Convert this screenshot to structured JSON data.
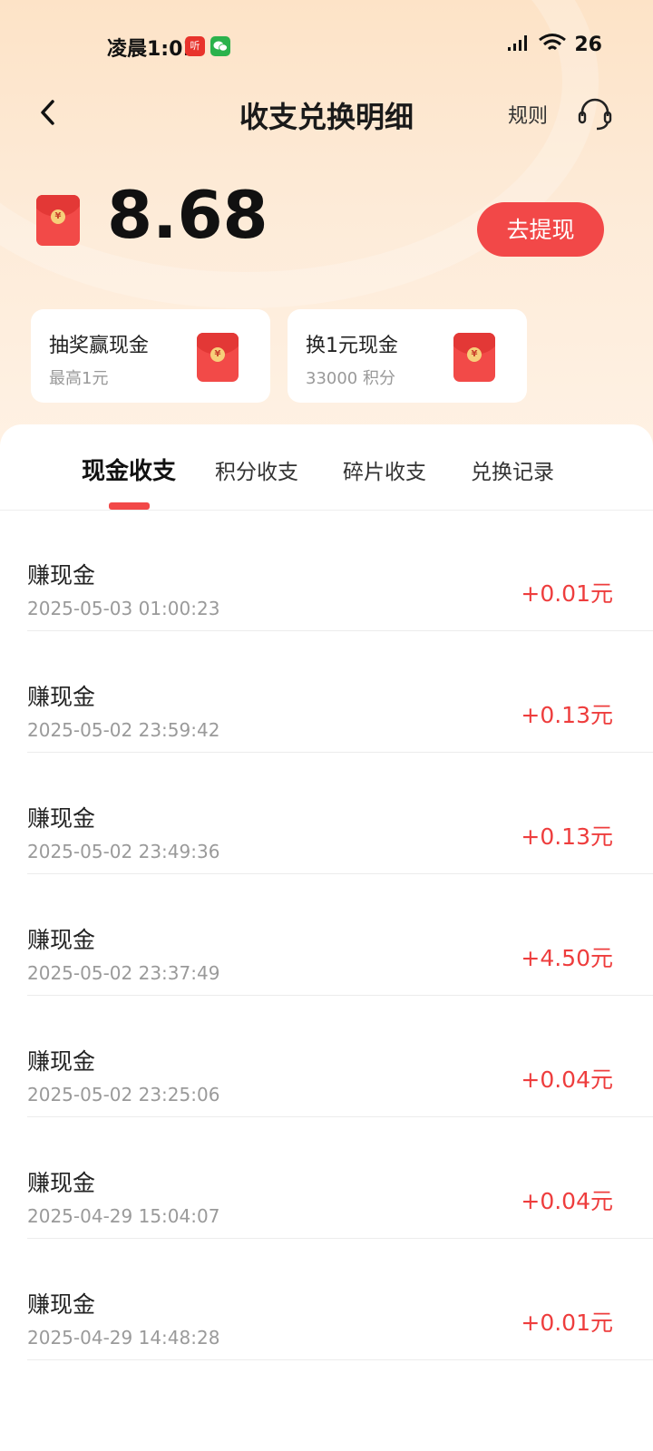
{
  "status_bar": {
    "time": "凌晨1:01",
    "app_icon_1": "听",
    "battery": "26"
  },
  "nav": {
    "title": "收支兑换明细",
    "rules_label": "规则",
    "back_icon": "chevron-left-icon",
    "support_icon": "headset-icon"
  },
  "balance": {
    "value": "8.68",
    "withdraw_label": "去提现"
  },
  "promos": [
    {
      "title": "抽奖赢现金",
      "subtitle": "最高1元"
    },
    {
      "title": "换1元现金",
      "subtitle": "33000 积分"
    }
  ],
  "tabs": [
    {
      "label": "现金收支",
      "active": true
    },
    {
      "label": "积分收支",
      "active": false
    },
    {
      "label": "碎片收支",
      "active": false
    },
    {
      "label": "兑换记录",
      "active": false
    }
  ],
  "transactions": [
    {
      "title": "赚现金",
      "time": "2025-05-03 01:00:23",
      "amount": "+0.01元"
    },
    {
      "title": "赚现金",
      "time": "2025-05-02 23:59:42",
      "amount": "+0.13元"
    },
    {
      "title": "赚现金",
      "time": "2025-05-02 23:49:36",
      "amount": "+0.13元"
    },
    {
      "title": "赚现金",
      "time": "2025-05-02 23:37:49",
      "amount": "+4.50元"
    },
    {
      "title": "赚现金",
      "time": "2025-05-02 23:25:06",
      "amount": "+0.04元"
    },
    {
      "title": "赚现金",
      "time": "2025-04-29 15:04:07",
      "amount": "+0.04元"
    },
    {
      "title": "赚现金",
      "time": "2025-04-29 14:48:28",
      "amount": "+0.01元"
    }
  ],
  "colors": {
    "accent": "#f24848",
    "amount": "#ee3d3d",
    "header_bg": "#fde3c7"
  }
}
